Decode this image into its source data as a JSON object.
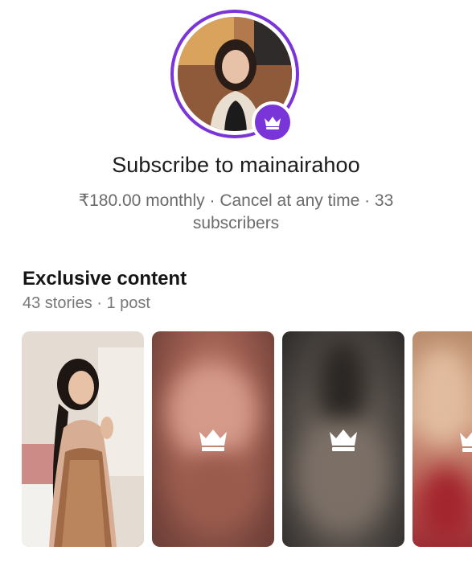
{
  "profile": {
    "username": "mainairahoo",
    "avatar_icon": "crown-icon",
    "accent_color": "#7a35d8"
  },
  "subscribe": {
    "title": "Subscribe to mainairahoo",
    "price_line": "₹180.00 monthly · Cancel at any time · 33 subscribers"
  },
  "exclusive": {
    "title": "Exclusive content",
    "counts": "43 stories · 1 post",
    "tiles": [
      {
        "locked": false
      },
      {
        "locked": true,
        "icon": "crown-icon"
      },
      {
        "locked": true,
        "icon": "crown-icon"
      },
      {
        "locked": true,
        "icon": "crown-icon"
      }
    ]
  }
}
